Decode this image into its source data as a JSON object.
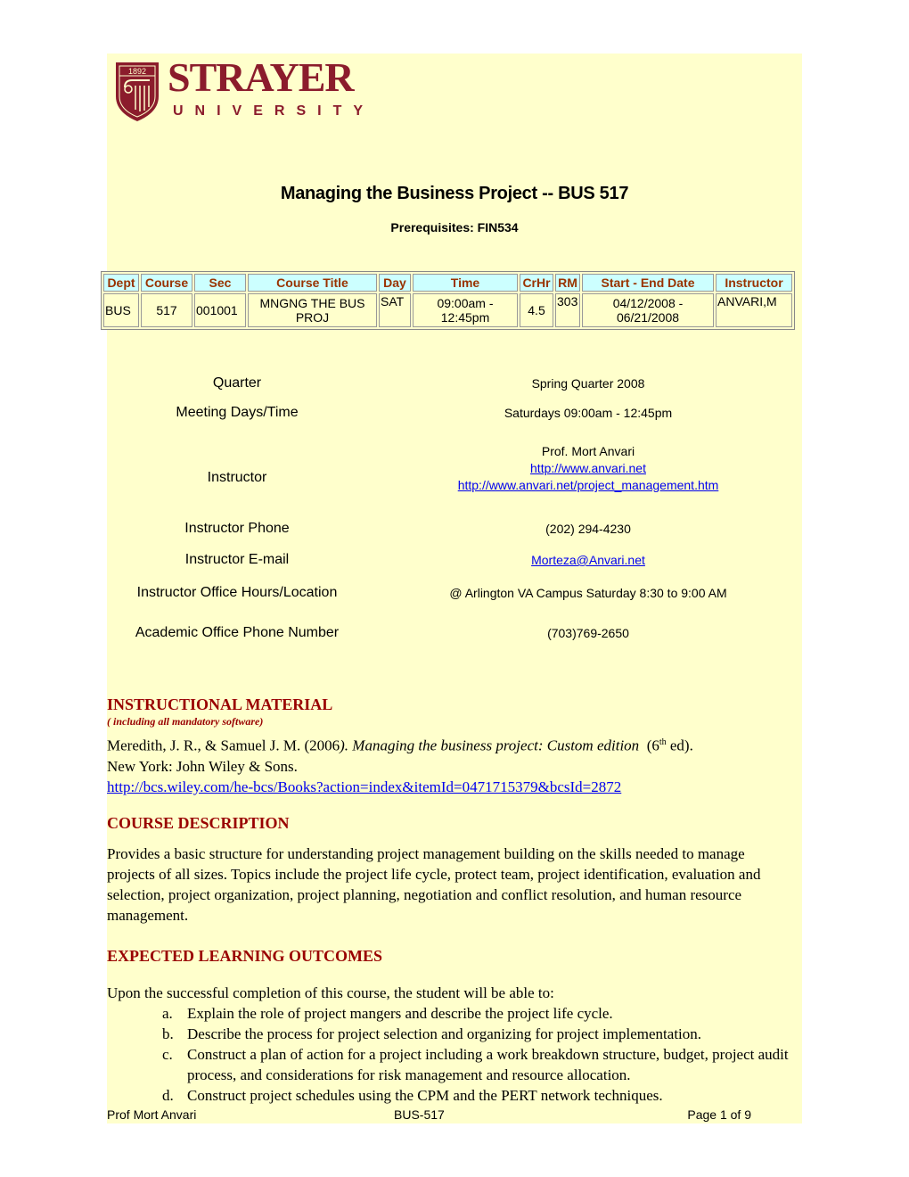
{
  "logo": {
    "year": "1892",
    "name": "STRAYER",
    "subname": "UNIVERSITY",
    "brand_color": "#8b1c2c"
  },
  "header": {
    "title": "Managing the Business Project -- BUS 517",
    "prerequisites": "Prerequisites: FIN534"
  },
  "schedule_table": {
    "columns": [
      "Dept",
      "Course",
      "Sec",
      "Course Title",
      "Day",
      "Time",
      "CrHr",
      "RM",
      "Start - End Date",
      "Instructor"
    ],
    "rows": [
      {
        "dept": "BUS",
        "course": "517",
        "sec": "001001",
        "title_line1": "MNGNG THE BUS",
        "title_line2": "PROJ",
        "day": "SAT",
        "time_line1": "09:00am -",
        "time_line2": "12:45pm",
        "crhr": "4.5",
        "rm": "303",
        "date_line1": "04/12/2008 -",
        "date_line2": "06/21/2008",
        "instructor": "ANVARI,M"
      }
    ],
    "header_bg": "#ccffff",
    "header_color": "#993300"
  },
  "info": {
    "quarter_label": "Quarter",
    "quarter_value": "Spring Quarter 2008",
    "meeting_label": "Meeting Days/Time",
    "meeting_value": "Saturdays 09:00am - 12:45pm",
    "instructor_label": "Instructor",
    "instructor_name": "Prof. Mort Anvari",
    "instructor_link1": "http://www.anvari.net",
    "instructor_link2": "http://www.anvari.net/project_management.htm",
    "phone_label": "Instructor Phone",
    "phone_value": "(202) 294-4230",
    "email_label": "Instructor E-mail",
    "email_value": "Morteza@Anvari.net",
    "office_label": "Instructor Office Hours/Location",
    "office_value": "@ Arlington VA Campus Saturday 8:30 to 9:00 AM",
    "academic_label": "Academic Office Phone Number",
    "academic_value": "(703)769-2650"
  },
  "instructional_material": {
    "heading": "INSTRUCTIONAL MATERIAL",
    "subheading": "( including all mandatory software)",
    "citation_authors": "Meredith, J. R., & Samuel J. M. (2006",
    "citation_title": "). Managing the business project: Custom edition",
    "citation_edition_pre": "  (6",
    "citation_edition_sup": "th",
    "citation_edition_post": " ed).",
    "publisher": "New York: John Wiley & Sons.",
    "link": "http://bcs.wiley.com/he-bcs/Books?action=index&itemId=0471715379&bcsId=2872"
  },
  "course_description": {
    "heading": "COURSE DESCRIPTION",
    "text": "Provides a basic structure for understanding project management building on the skills needed to manage projects of all sizes. Topics include the project life cycle, protect team, project identification, evaluation and selection, project organization, project planning, negotiation and conflict resolution, and human resource management."
  },
  "learning_outcomes": {
    "heading": "EXPECTED LEARNING OUTCOMES",
    "intro": "Upon the successful completion of this course, the student will be able to:",
    "items": [
      {
        "marker": "a.",
        "text": "Explain the role of project mangers and describe the project life cycle."
      },
      {
        "marker": "b.",
        "text": "Describe the process for project selection and organizing for project implementation."
      },
      {
        "marker": "c.",
        "text": "Construct a plan of action for a project including a work breakdown structure, budget, project audit process, and considerations for risk management and resource allocation."
      },
      {
        "marker": "d.",
        "text": "Construct project schedules using the CPM and the PERT network techniques."
      }
    ]
  },
  "footer": {
    "left": "Prof Mort Anvari",
    "center": "BUS-517",
    "right": "Page 1 of 9"
  }
}
